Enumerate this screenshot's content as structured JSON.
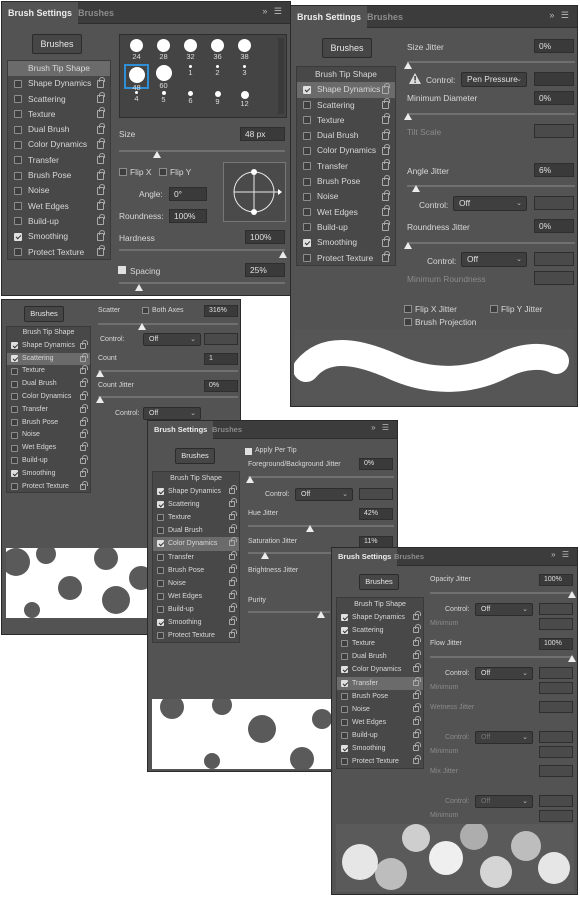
{
  "tabs": {
    "settings": "Brush Settings",
    "brushes": "Brushes"
  },
  "brushes_button": "Brushes",
  "sidebar_items": [
    "Brush Tip Shape",
    "Shape Dynamics",
    "Scattering",
    "Texture",
    "Dual Brush",
    "Color Dynamics",
    "Transfer",
    "Brush Pose",
    "Noise",
    "Wet Edges",
    "Build-up",
    "Smoothing",
    "Protect Texture"
  ],
  "p1": {
    "checked": [
      false,
      false,
      false,
      false,
      false,
      false,
      false,
      false,
      false,
      false,
      true,
      false
    ],
    "tips": [
      "24",
      "28",
      "32",
      "36",
      "38",
      "48",
      "60",
      "1",
      "2",
      "3",
      "4",
      "5",
      "6",
      "9",
      "12"
    ],
    "size_label": "Size",
    "size_value": "48 px",
    "flipx": "Flip X",
    "flipy": "Flip Y",
    "angle_label": "Angle:",
    "angle_value": "0°",
    "roundness_label": "Roundness:",
    "roundness_value": "100%",
    "hardness_label": "Hardness",
    "hardness_value": "100%",
    "spacing_label": "Spacing",
    "spacing_value": "25%"
  },
  "p2": {
    "checked": [
      true,
      false,
      false,
      false,
      false,
      false,
      false,
      false,
      false,
      false,
      true,
      false
    ],
    "size_jitter": "Size Jitter",
    "size_jitter_value": "0%",
    "control": "Control:",
    "pen_pressure": "Pen Pressure",
    "min_diameter": "Minimum Diameter",
    "min_diameter_value": "0%",
    "tilt_scale": "Tilt Scale",
    "angle_jitter": "Angle Jitter",
    "angle_jitter_value": "6%",
    "off": "Off",
    "roundness_jitter": "Roundness Jitter",
    "roundness_jitter_value": "0%",
    "min_roundness": "Minimum Roundness",
    "flip_x_jitter": "Flip X Jitter",
    "flip_y_jitter": "Flip Y Jitter",
    "brush_projection": "Brush Projection"
  },
  "p3": {
    "checked": [
      true,
      true,
      false,
      false,
      false,
      false,
      false,
      false,
      false,
      false,
      true,
      false
    ],
    "scatter": "Scatter",
    "both_axes": "Both Axes",
    "scatter_value": "316%",
    "control": "Control:",
    "off": "Off",
    "count": "Count",
    "count_value": "1",
    "count_jitter": "Count Jitter",
    "count_jitter_value": "0%"
  },
  "p4": {
    "checked": [
      true,
      true,
      false,
      false,
      true,
      false,
      false,
      false,
      false,
      false,
      true,
      false
    ],
    "apply_per_tip": "Apply Per Tip",
    "fg_bg_jitter": "Foreground/Background Jitter",
    "fg_bg_value": "0%",
    "control": "Control:",
    "off": "Off",
    "hue_jitter": "Hue Jitter",
    "hue_value": "42%",
    "sat_jitter": "Saturation Jitter",
    "sat_value": "11%",
    "bright_jitter": "Brightness Jitter",
    "purity": "Purity"
  },
  "p5": {
    "checked": [
      true,
      true,
      false,
      false,
      true,
      true,
      false,
      false,
      false,
      false,
      true,
      false
    ],
    "opacity_jitter": "Opacity Jitter",
    "opacity_value": "100%",
    "control": "Control:",
    "off": "Off",
    "minimum": "Minimum",
    "flow_jitter": "Flow Jitter",
    "flow_value": "100%",
    "wetness_jitter": "Wetness Jitter",
    "mix_jitter": "Mix Jitter"
  },
  "colors": {
    "panel": "#535353",
    "tabbar": "#3c3c3c",
    "accent": "#2e8fd6"
  }
}
